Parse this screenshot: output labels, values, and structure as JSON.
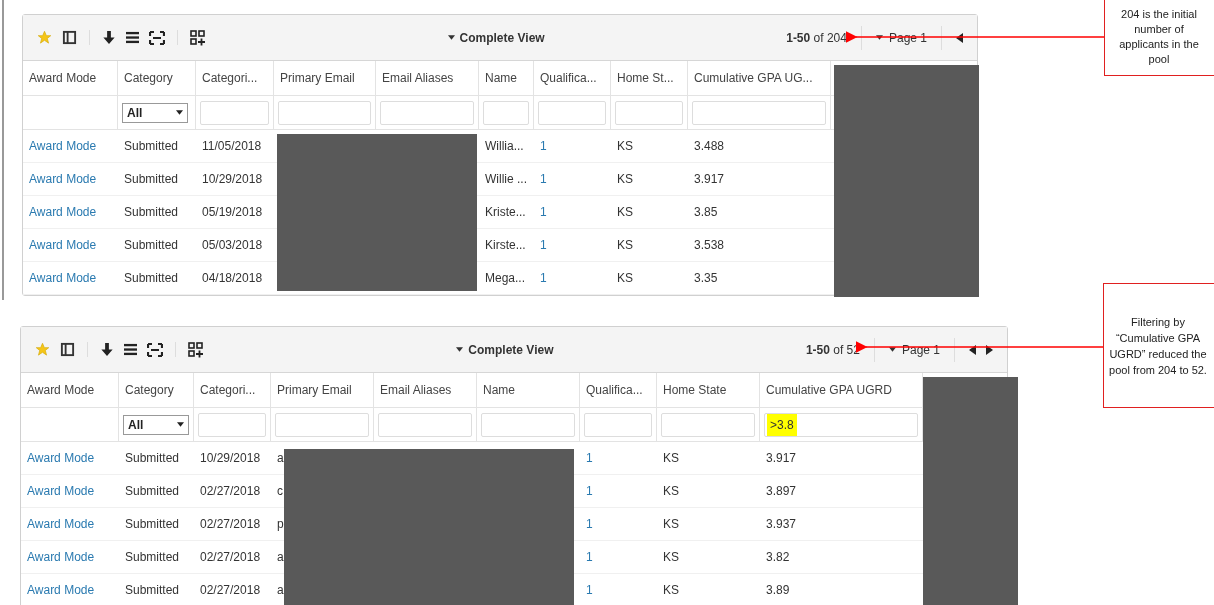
{
  "panels": [
    {
      "toolbar": {
        "view": "Complete View",
        "range": "1-50",
        "total": "of 204",
        "page": "Page 1",
        "next_visible": false
      },
      "columns": [
        {
          "label": "Award Mode"
        },
        {
          "label": "Category",
          "filter": {
            "kind": "select",
            "value": "All"
          }
        },
        {
          "label": "Categori...",
          "filter": {
            "kind": "text",
            "highlighted": false
          }
        },
        {
          "label": "Primary Email",
          "filter": {
            "kind": "text",
            "highlighted": false
          }
        },
        {
          "label": "Email Aliases",
          "filter": {
            "kind": "text",
            "highlighted": false
          }
        },
        {
          "label": "Name",
          "filter": {
            "kind": "text",
            "highlighted": false
          }
        },
        {
          "label": "Qualifica...",
          "filter": {
            "kind": "text",
            "highlighted": false
          }
        },
        {
          "label": "Home St...",
          "filter": {
            "kind": "text",
            "highlighted": false
          }
        },
        {
          "label": "Cumulative GPA UG...",
          "filter": {
            "kind": "text",
            "highlighted": false
          }
        }
      ],
      "rows": [
        {
          "award_mode": "Award Mode",
          "category": "Submitted",
          "categorized": "11/05/2018",
          "name": "Willia...",
          "qualification": "1",
          "home_state": "KS",
          "gpa": "3.488"
        },
        {
          "award_mode": "Award Mode",
          "category": "Submitted",
          "categorized": "10/29/2018",
          "name": "Willie ...",
          "qualification": "1",
          "home_state": "KS",
          "gpa": "3.917"
        },
        {
          "award_mode": "Award Mode",
          "category": "Submitted",
          "categorized": "05/19/2018",
          "name": "Kriste...",
          "qualification": "1",
          "home_state": "KS",
          "gpa": "3.85"
        },
        {
          "award_mode": "Award Mode",
          "category": "Submitted",
          "categorized": "05/03/2018",
          "name": "Kirste...",
          "qualification": "1",
          "home_state": "KS",
          "gpa": "3.538"
        },
        {
          "award_mode": "Award Mode",
          "category": "Submitted",
          "categorized": "04/18/2018",
          "name": "Mega...",
          "qualification": "1",
          "home_state": "KS",
          "gpa": "3.35"
        }
      ]
    },
    {
      "toolbar": {
        "view": "Complete View",
        "range": "1-50",
        "total": "of 52",
        "page": "Page 1",
        "next_visible": true
      },
      "columns": [
        {
          "label": "Award Mode"
        },
        {
          "label": "Category",
          "filter": {
            "kind": "select",
            "value": "All"
          }
        },
        {
          "label": "Categori...",
          "filter": {
            "kind": "text",
            "highlighted": false
          }
        },
        {
          "label": "Primary Email",
          "filter": {
            "kind": "text",
            "highlighted": false
          }
        },
        {
          "label": "Email Aliases",
          "filter": {
            "kind": "text",
            "highlighted": false
          }
        },
        {
          "label": "Name",
          "filter": {
            "kind": "text",
            "highlighted": false
          }
        },
        {
          "label": "Qualifica...",
          "filter": {
            "kind": "text",
            "highlighted": false
          }
        },
        {
          "label": "Home State",
          "filter": {
            "kind": "text",
            "highlighted": false
          }
        },
        {
          "label": "Cumulative GPA UGRD",
          "filter": {
            "kind": "text",
            "value": ">3.8",
            "highlighted": true
          }
        }
      ],
      "rows": [
        {
          "award_mode": "Award Mode",
          "category": "Submitted",
          "categorized": "10/29/2018",
          "primary_email": "a",
          "qualification": "1",
          "home_state": "KS",
          "gpa": "3.917"
        },
        {
          "award_mode": "Award Mode",
          "category": "Submitted",
          "categorized": "02/27/2018",
          "primary_email": "c",
          "qualification": "1",
          "home_state": "KS",
          "gpa": "3.897"
        },
        {
          "award_mode": "Award Mode",
          "category": "Submitted",
          "categorized": "02/27/2018",
          "primary_email": "p",
          "qualification": "1",
          "home_state": "KS",
          "gpa": "3.937"
        },
        {
          "award_mode": "Award Mode",
          "category": "Submitted",
          "categorized": "02/27/2018",
          "primary_email": "a",
          "qualification": "1",
          "home_state": "KS",
          "gpa": "3.82"
        },
        {
          "award_mode": "Award Mode",
          "category": "Submitted",
          "categorized": "02/27/2018",
          "primary_email": "a",
          "qualification": "1",
          "home_state": "KS",
          "gpa": "3.89"
        }
      ]
    }
  ],
  "callouts": [
    "204 is the initial number of applicants in the pool",
    "Filtering by “Cumulative GPA UGRD” reduced the pool from 204 to 52."
  ]
}
